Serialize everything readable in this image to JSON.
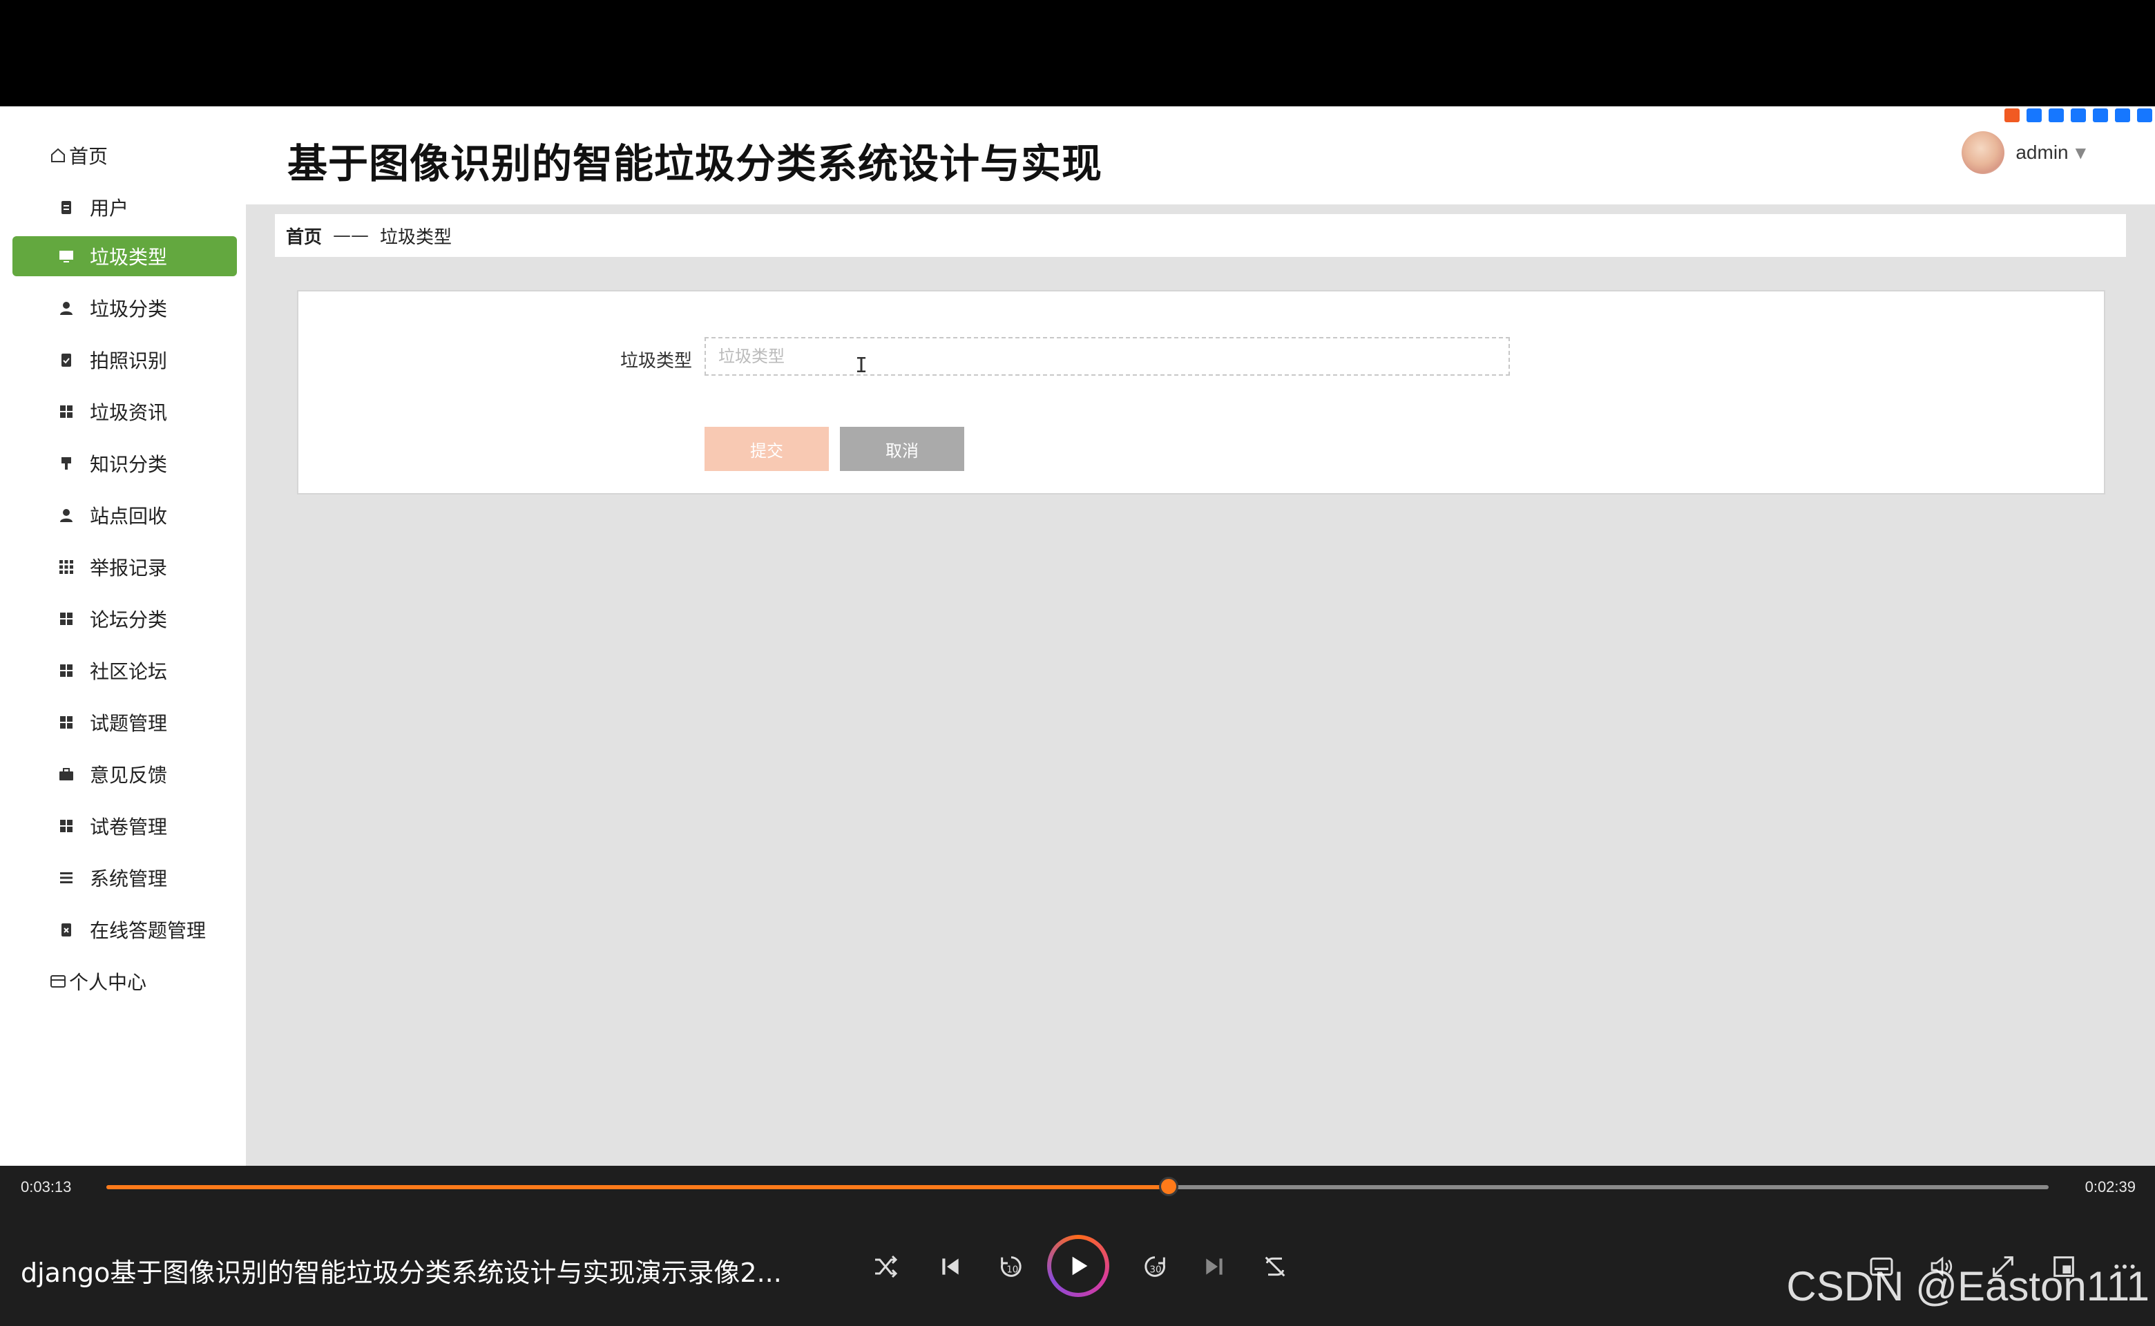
{
  "app": {
    "title": "基于图像识别的智能垃圾分类系统设计与实现",
    "user": {
      "name": "admin",
      "caret": "▼"
    }
  },
  "sidebar": {
    "items": [
      {
        "label": "首页",
        "icon": "home-icon"
      },
      {
        "label": "用户",
        "icon": "clipboard-icon"
      },
      {
        "label": "垃圾类型",
        "icon": "monitor-icon",
        "active": true
      },
      {
        "label": "垃圾分类",
        "icon": "user-icon"
      },
      {
        "label": "拍照识别",
        "icon": "clipboard-check-icon"
      },
      {
        "label": "垃圾资讯",
        "icon": "grid-icon"
      },
      {
        "label": "知识分类",
        "icon": "pushpin-icon"
      },
      {
        "label": "站点回收",
        "icon": "user-icon"
      },
      {
        "label": "举报记录",
        "icon": "grid9-icon"
      },
      {
        "label": "论坛分类",
        "icon": "grid-icon"
      },
      {
        "label": "社区论坛",
        "icon": "grid-icon"
      },
      {
        "label": "试题管理",
        "icon": "grid-icon"
      },
      {
        "label": "意见反馈",
        "icon": "briefcase-icon"
      },
      {
        "label": "试卷管理",
        "icon": "grid-icon"
      },
      {
        "label": "系统管理",
        "icon": "menu-icon"
      },
      {
        "label": "在线答题管理",
        "icon": "clipboard-x-icon"
      },
      {
        "label": "个人中心",
        "icon": "card-icon"
      }
    ]
  },
  "breadcrumb": {
    "home": "首页",
    "separator": "——",
    "current": "垃圾类型"
  },
  "form": {
    "field_label": "垃圾类型",
    "field_placeholder": "垃圾类型",
    "field_value": "",
    "submit_label": "提交",
    "cancel_label": "取消"
  },
  "player": {
    "elapsed": "0:03:13",
    "remaining": "0:02:39",
    "progress": 0.547,
    "video_title": "django基于图像识别的智能垃圾分类系统设计与实现演示录像2...",
    "watermark": "CSDN @Easton111",
    "accent_color": "#ff7a1a"
  },
  "colors": {
    "sidebar_active": "#63a83f",
    "submit_button": "#f8c9b3",
    "cancel_button": "#aaaaaa"
  }
}
